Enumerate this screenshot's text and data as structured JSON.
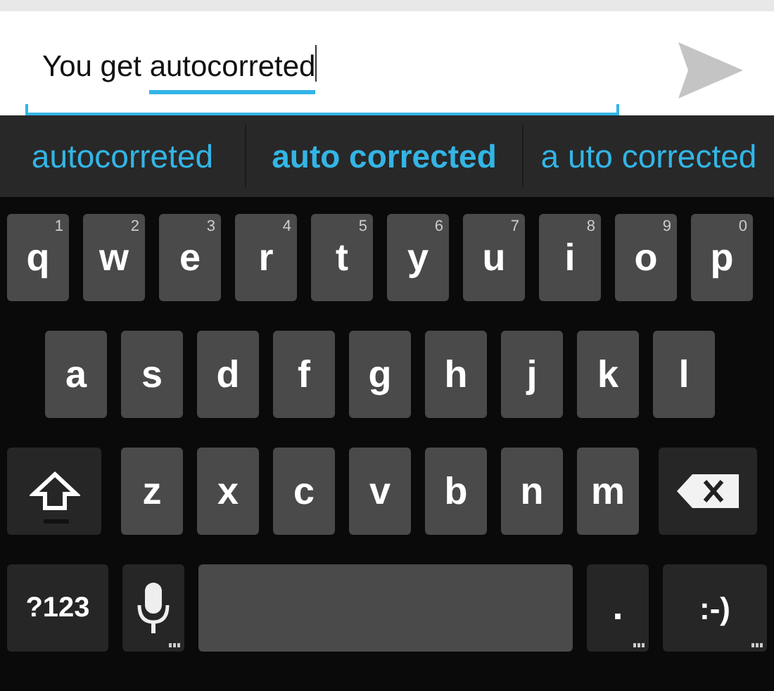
{
  "message_field": {
    "text": "You get ",
    "composing": "autocorreted",
    "focused": true
  },
  "suggestions": [
    {
      "label": "autocorreted",
      "selected": false
    },
    {
      "label": "auto corrected",
      "selected": true
    },
    {
      "label": "a uto corrected",
      "selected": false
    }
  ],
  "keyboard": {
    "rows": [
      {
        "keys": [
          {
            "kind": "letter",
            "label": "q",
            "hint": "1"
          },
          {
            "kind": "letter",
            "label": "w",
            "hint": "2"
          },
          {
            "kind": "letter",
            "label": "e",
            "hint": "3"
          },
          {
            "kind": "letter",
            "label": "r",
            "hint": "4"
          },
          {
            "kind": "letter",
            "label": "t",
            "hint": "5"
          },
          {
            "kind": "letter",
            "label": "y",
            "hint": "6"
          },
          {
            "kind": "letter",
            "label": "u",
            "hint": "7"
          },
          {
            "kind": "letter",
            "label": "i",
            "hint": "8"
          },
          {
            "kind": "letter",
            "label": "o",
            "hint": "9"
          },
          {
            "kind": "letter",
            "label": "p",
            "hint": "0"
          }
        ]
      },
      {
        "keys": [
          {
            "kind": "letter",
            "label": "a"
          },
          {
            "kind": "letter",
            "label": "s"
          },
          {
            "kind": "letter",
            "label": "d"
          },
          {
            "kind": "letter",
            "label": "f"
          },
          {
            "kind": "letter",
            "label": "g"
          },
          {
            "kind": "letter",
            "label": "h"
          },
          {
            "kind": "letter",
            "label": "j"
          },
          {
            "kind": "letter",
            "label": "k"
          },
          {
            "kind": "letter",
            "label": "l"
          }
        ]
      },
      {
        "keys": [
          {
            "kind": "shift"
          },
          {
            "kind": "letter",
            "label": "z"
          },
          {
            "kind": "letter",
            "label": "x"
          },
          {
            "kind": "letter",
            "label": "c"
          },
          {
            "kind": "letter",
            "label": "v"
          },
          {
            "kind": "letter",
            "label": "b"
          },
          {
            "kind": "letter",
            "label": "n"
          },
          {
            "kind": "letter",
            "label": "m"
          },
          {
            "kind": "delete"
          }
        ]
      },
      {
        "keys": [
          {
            "kind": "symbols",
            "label": "?123"
          },
          {
            "kind": "mic",
            "more_keys": true
          },
          {
            "kind": "space"
          },
          {
            "kind": "period",
            "label": ".",
            "more_keys": true
          },
          {
            "kind": "smiley",
            "label": ":-)",
            "more_keys": true
          }
        ]
      }
    ]
  }
}
